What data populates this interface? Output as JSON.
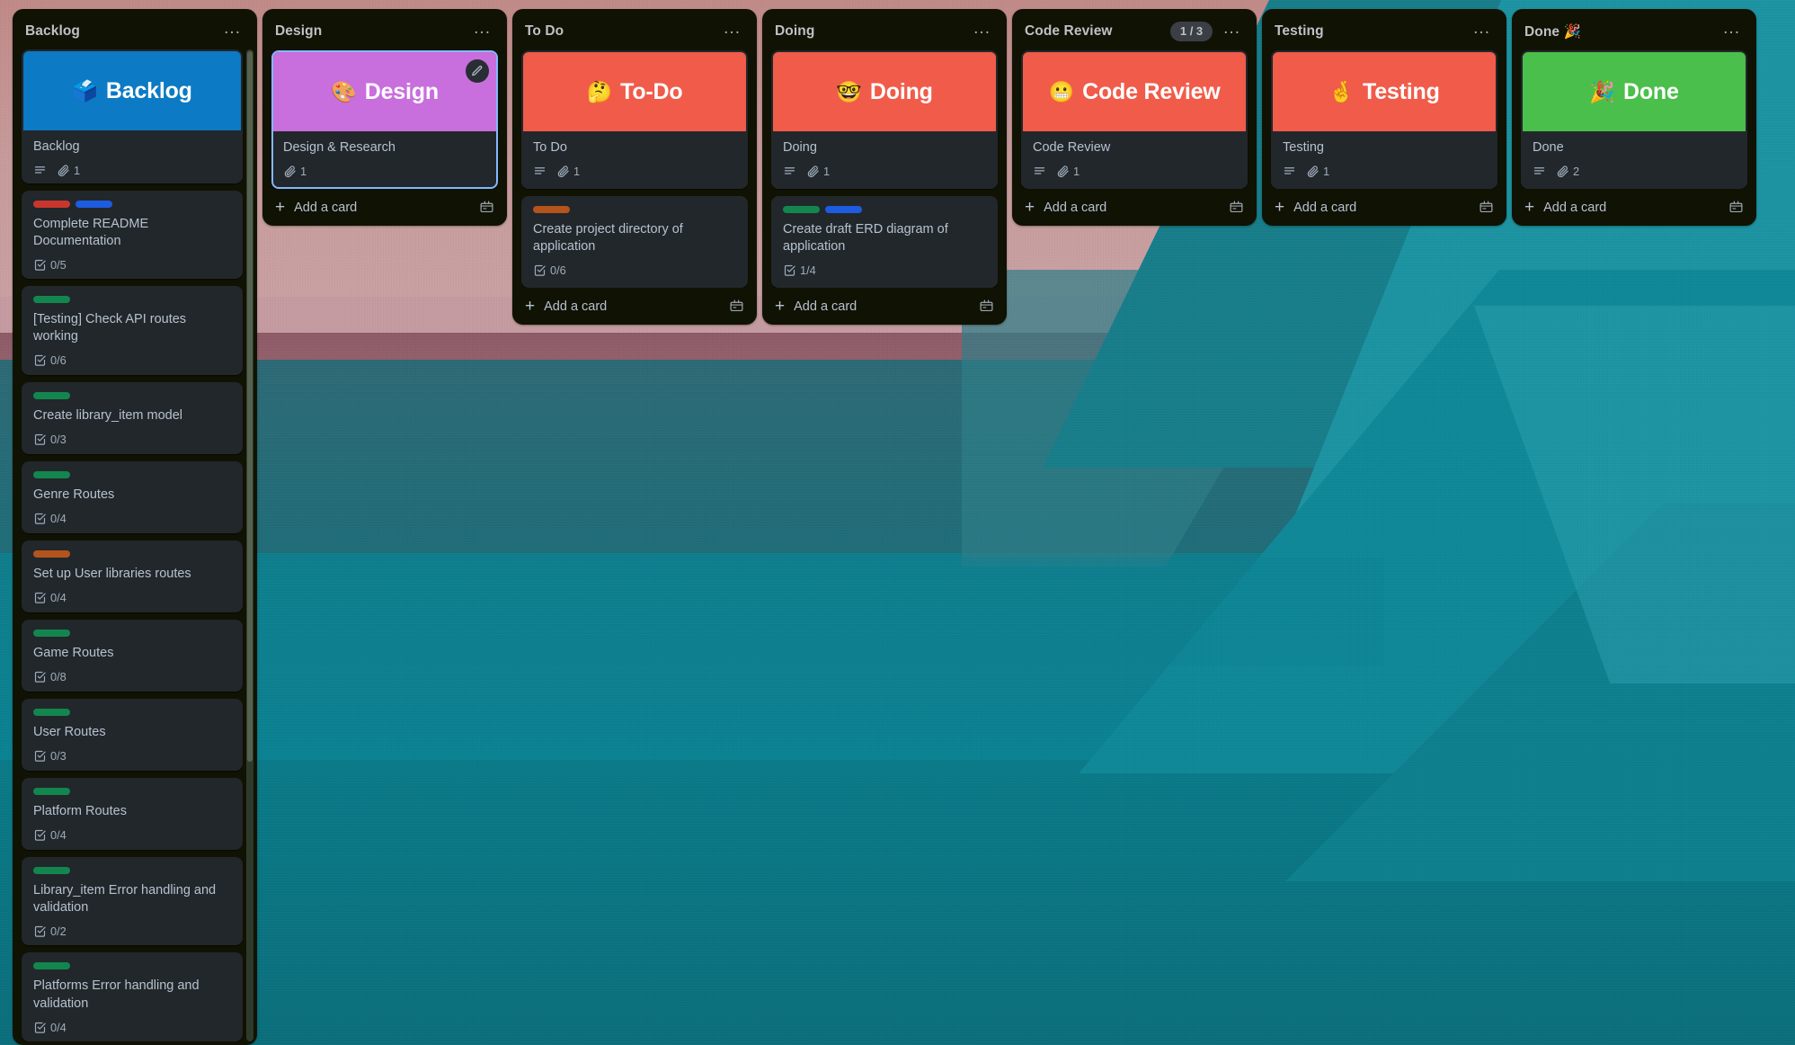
{
  "board": {
    "accent_selected": "#85b8ff",
    "list_bg": "#101204",
    "card_bg": "#22272b"
  },
  "add_card": {
    "label": "Add a card",
    "plus": "+",
    "template_icon": "card-template-icon"
  },
  "menu_glyph": "...",
  "lists": [
    {
      "name": "backlog",
      "title": "Backlog",
      "wip": null,
      "scrollable": true,
      "cards": [
        {
          "name": "backlog-cover-card",
          "cover": {
            "color": "#0c7ac4",
            "emoji": "🗳️",
            "text": "Backlog"
          },
          "title": "Backlog",
          "labels": [],
          "badges": {
            "description": true,
            "attachments": "1"
          },
          "selected": false
        },
        {
          "name": "card-complete-readme",
          "title": "Complete README Documentation",
          "labels": [
            "#c9372c",
            "#1d5ce0"
          ],
          "checklist": "0/5"
        },
        {
          "name": "card-testing-check-api",
          "title": "[Testing] Check API routes working",
          "labels": [
            "#13864f"
          ],
          "checklist": "0/6"
        },
        {
          "name": "card-create-library-item-model",
          "title": "Create library_item model",
          "labels": [
            "#13864f"
          ],
          "checklist": "0/3"
        },
        {
          "name": "card-genre-routes",
          "title": "Genre Routes",
          "labels": [
            "#13864f"
          ],
          "checklist": "0/4"
        },
        {
          "name": "card-setup-user-libraries-routes",
          "title": "Set up User libraries routes",
          "labels": [
            "#b3541d"
          ],
          "checklist": "0/4"
        },
        {
          "name": "card-game-routes",
          "title": "Game Routes",
          "labels": [
            "#13864f"
          ],
          "checklist": "0/8"
        },
        {
          "name": "card-user-routes",
          "title": "User Routes",
          "labels": [
            "#13864f"
          ],
          "checklist": "0/3"
        },
        {
          "name": "card-platform-routes",
          "title": "Platform Routes",
          "labels": [
            "#13864f"
          ],
          "checklist": "0/4"
        },
        {
          "name": "card-library-item-error-handling",
          "title": "Library_item Error handling and validation",
          "labels": [
            "#13864f"
          ],
          "checklist": "0/2"
        },
        {
          "name": "card-platforms-error-handling",
          "title": "Platforms Error handling and validation",
          "labels": [
            "#13864f"
          ],
          "checklist": "0/4"
        }
      ]
    },
    {
      "name": "design",
      "title": "Design",
      "wip": null,
      "scrollable": false,
      "cards": [
        {
          "name": "design-cover-card",
          "cover": {
            "color": "#c86edd",
            "emoji": "🎨",
            "text": "Design",
            "edit_icon": "pencil-icon"
          },
          "title": "Design & Research",
          "labels": [],
          "badges": {
            "description": false,
            "attachments": "1"
          },
          "selected": true
        }
      ]
    },
    {
      "name": "to-do",
      "title": "To Do",
      "wip": null,
      "scrollable": false,
      "cards": [
        {
          "name": "todo-cover-card",
          "cover": {
            "color": "#f15b4a",
            "emoji": "🤔",
            "text": "To-Do"
          },
          "title": "To Do",
          "labels": [],
          "badges": {
            "description": true,
            "attachments": "1"
          },
          "selected": false
        },
        {
          "name": "card-create-project-directory",
          "title": "Create project directory of application",
          "labels": [
            "#b3541d"
          ],
          "checklist": "0/6"
        }
      ]
    },
    {
      "name": "doing",
      "title": "Doing",
      "wip": null,
      "scrollable": false,
      "cards": [
        {
          "name": "doing-cover-card",
          "cover": {
            "color": "#f15b4a",
            "emoji": "🤓",
            "text": "Doing"
          },
          "title": "Doing",
          "labels": [],
          "badges": {
            "description": true,
            "attachments": "1"
          },
          "selected": false
        },
        {
          "name": "card-create-draft-erd",
          "title": "Create draft ERD diagram of application",
          "labels": [
            "#13864f",
            "#1d5ce0"
          ],
          "checklist": "1/4"
        }
      ]
    },
    {
      "name": "code-review",
      "title": "Code Review",
      "wip": "1 / 3",
      "scrollable": false,
      "cards": [
        {
          "name": "code-review-cover-card",
          "cover": {
            "color": "#f15b4a",
            "emoji": "😬",
            "text": "Code Review"
          },
          "title": "Code Review",
          "labels": [],
          "badges": {
            "description": true,
            "attachments": "1"
          },
          "selected": false
        }
      ]
    },
    {
      "name": "testing",
      "title": "Testing",
      "wip": null,
      "scrollable": false,
      "cards": [
        {
          "name": "testing-cover-card",
          "cover": {
            "color": "#f15b4a",
            "emoji": "🤞",
            "text": "Testing"
          },
          "title": "Testing",
          "labels": [],
          "badges": {
            "description": true,
            "attachments": "1"
          },
          "selected": false
        }
      ]
    },
    {
      "name": "done",
      "title": "Done 🎉",
      "wip": null,
      "scrollable": false,
      "cards": [
        {
          "name": "done-cover-card",
          "cover": {
            "color": "#4bbf4b",
            "emoji": "🎉",
            "text": "Done"
          },
          "title": "Done",
          "labels": [],
          "badges": {
            "description": true,
            "attachments": "2"
          },
          "selected": false
        }
      ]
    }
  ]
}
